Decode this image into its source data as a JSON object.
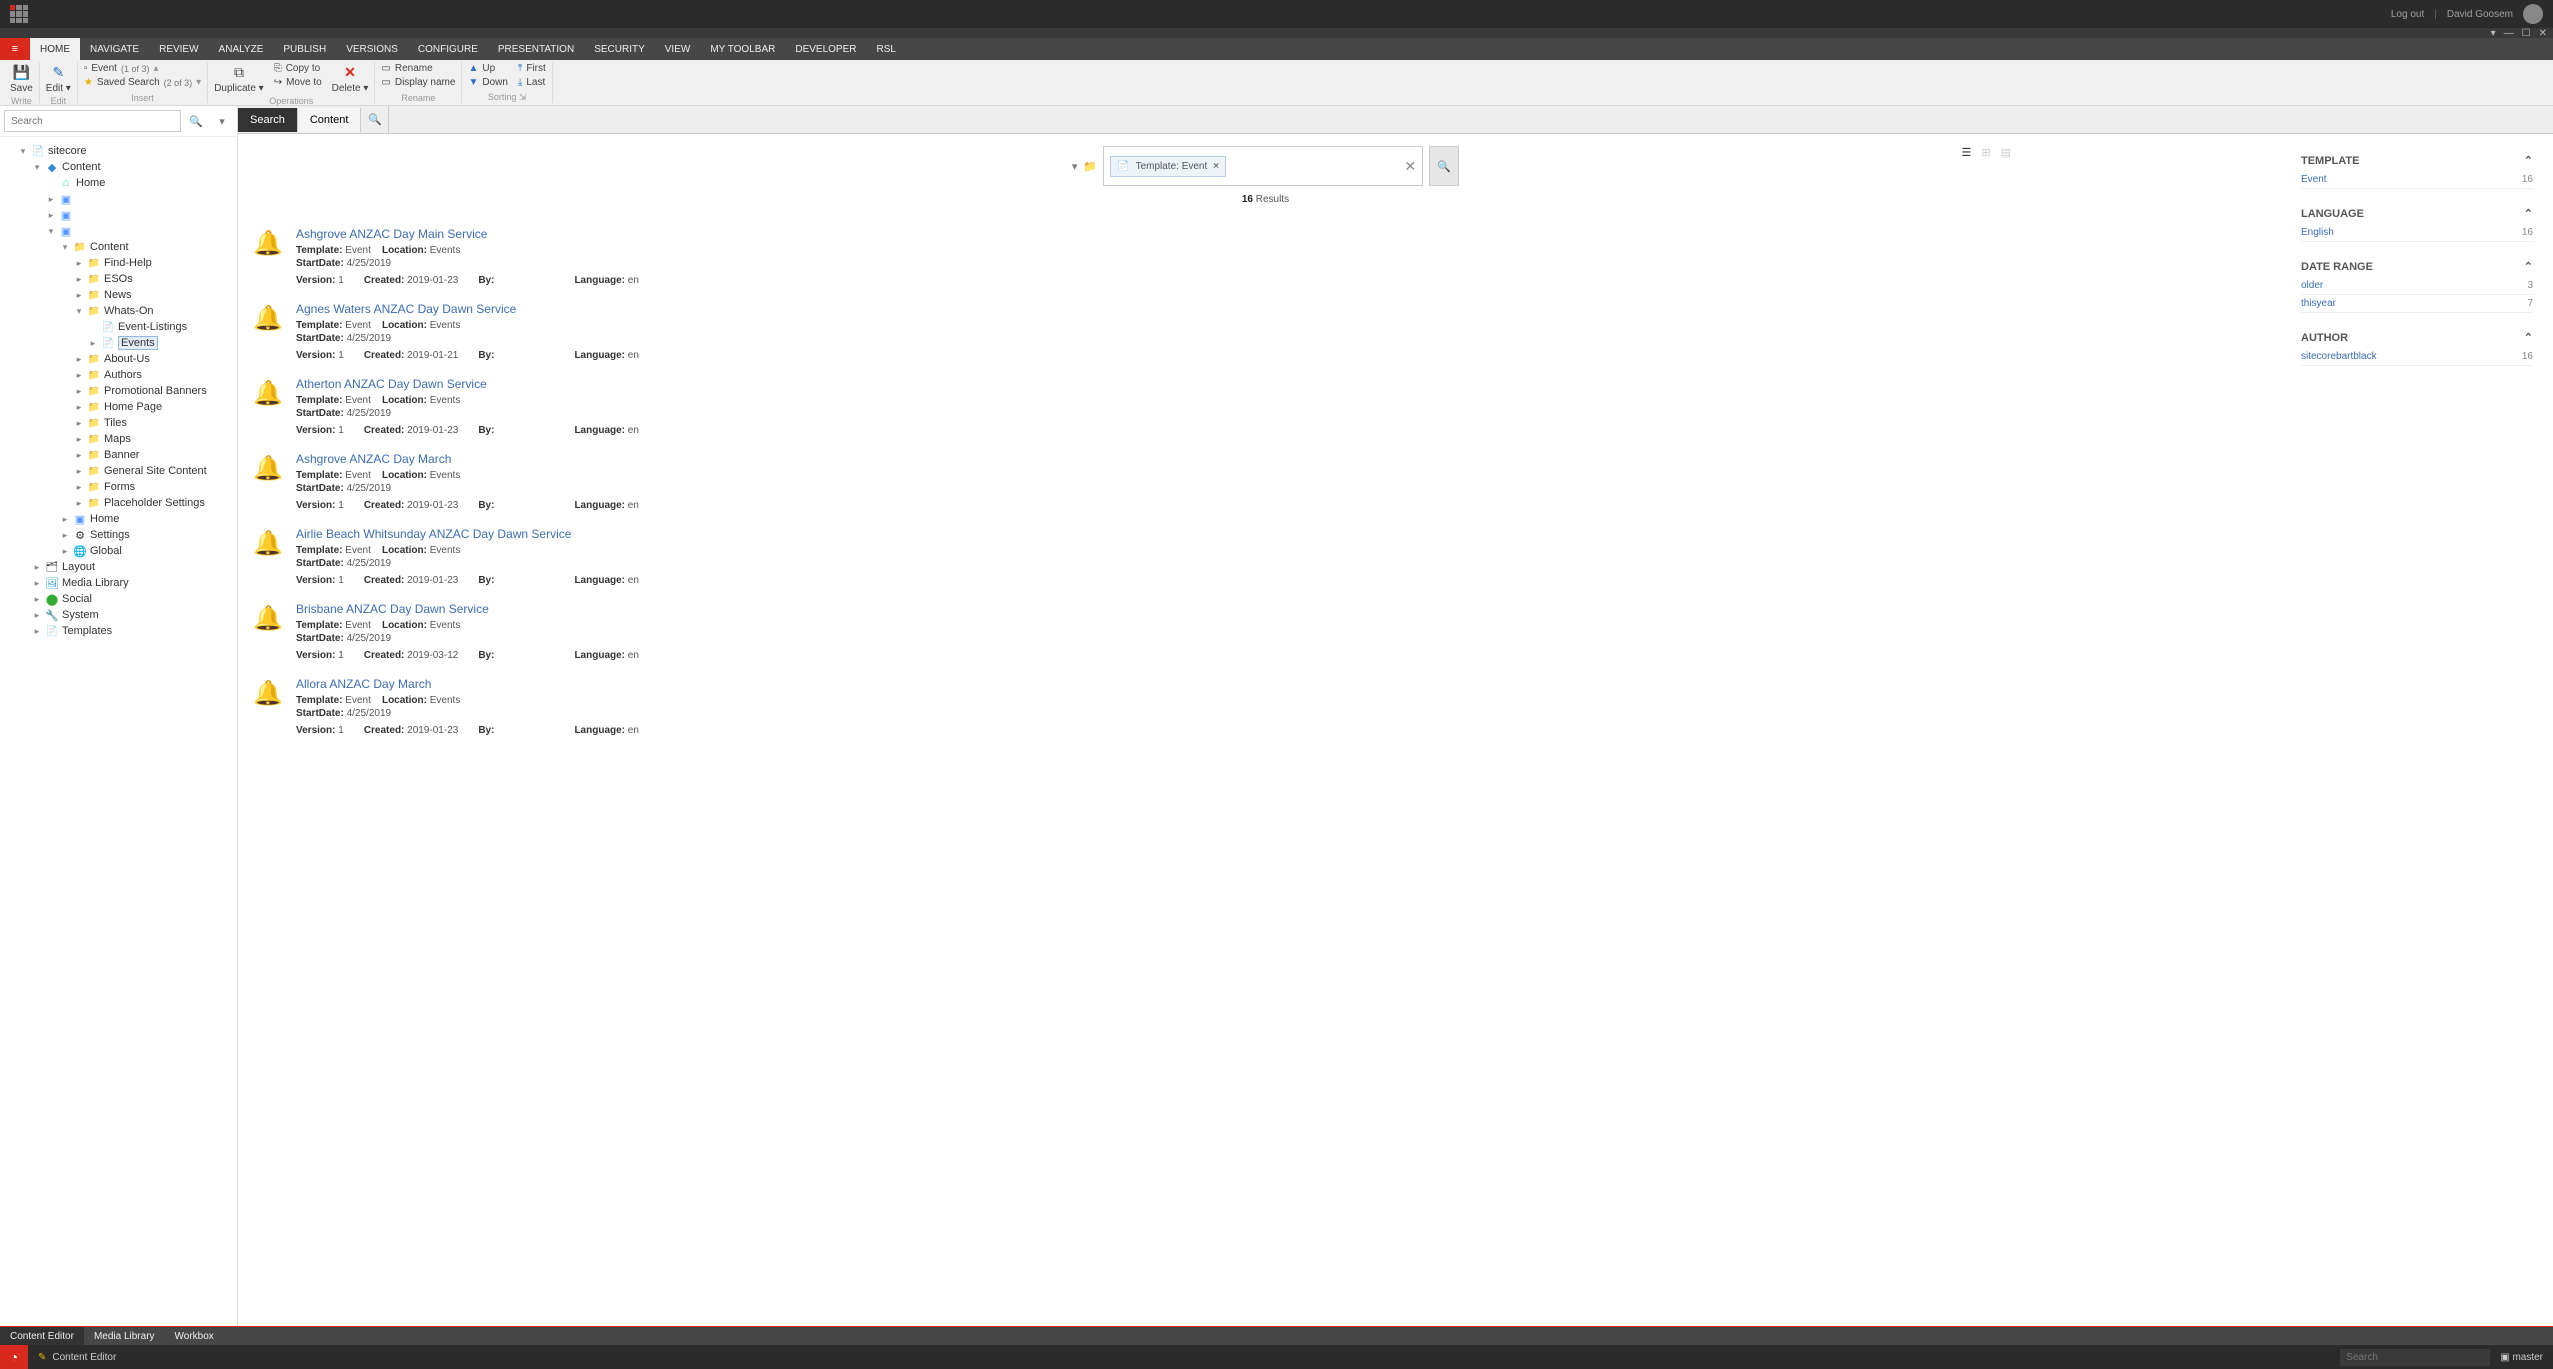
{
  "topbar": {
    "logout": "Log out",
    "username": "David Goosem"
  },
  "ribbonTabs": [
    "HOME",
    "NAVIGATE",
    "REVIEW",
    "ANALYZE",
    "PUBLISH",
    "VERSIONS",
    "CONFIGURE",
    "PRESENTATION",
    "SECURITY",
    "VIEW",
    "MY TOOLBAR",
    "DEVELOPER",
    "RSL"
  ],
  "ribbon": {
    "save": "Save",
    "write": "Write",
    "edit": "Edit",
    "editGroup": "Edit",
    "insert_event": "Event",
    "insert_event_count": "(1 of 3)",
    "insert_saved": "Saved Search",
    "insert_saved_count": "(2 of 3)",
    "insert": "Insert",
    "duplicate": "Duplicate",
    "copyto": "Copy to",
    "moveto": "Move to",
    "delete": "Delete",
    "operations": "Operations",
    "rename": "Rename",
    "displayname": "Display name",
    "renameGroup": "Rename",
    "up": "Up",
    "down": "Down",
    "first": "First",
    "last": "Last",
    "sorting": "Sorting"
  },
  "treeSearch": {
    "placeholder": "Search"
  },
  "tree": {
    "root": "sitecore",
    "content": "Content",
    "home": "Home",
    "contentFolder": "Content",
    "findHelp": "Find-Help",
    "esos": "ESOs",
    "news": "News",
    "whatsOn": "Whats-On",
    "eventListings": "Event-Listings",
    "events": "Events",
    "aboutUs": "About-Us",
    "authors": "Authors",
    "promoBanners": "Promotional Banners",
    "homePage": "Home Page",
    "tiles": "Tiles",
    "maps": "Maps",
    "banner": "Banner",
    "gsc": "General Site Content",
    "forms": "Forms",
    "placeholder": "Placeholder Settings",
    "home2": "Home",
    "settings": "Settings",
    "global": "Global",
    "layout": "Layout",
    "mediaLibrary": "Media Library",
    "social": "Social",
    "system": "System",
    "templates": "Templates"
  },
  "contentTabs": {
    "search": "Search",
    "content": "Content"
  },
  "searchFilter": {
    "label": "Template:",
    "value": "Event"
  },
  "resultCount": {
    "num": "16",
    "label": "Results"
  },
  "results": [
    {
      "title": "Ashgrove ANZAC Day Main Service",
      "template": "Event",
      "location": "Events",
      "startDate": "4/25/2019",
      "version": "1",
      "created": "2019-01-23",
      "by": "",
      "language": "en"
    },
    {
      "title": "Agnes Waters ANZAC Day Dawn Service",
      "template": "Event",
      "location": "Events",
      "startDate": "4/25/2019",
      "version": "1",
      "created": "2019-01-21",
      "by": "",
      "language": "en"
    },
    {
      "title": "Atherton ANZAC Day Dawn Service",
      "template": "Event",
      "location": "Events",
      "startDate": "4/25/2019",
      "version": "1",
      "created": "2019-01-23",
      "by": "",
      "language": "en"
    },
    {
      "title": "Ashgrove ANZAC Day March",
      "template": "Event",
      "location": "Events",
      "startDate": "4/25/2019",
      "version": "1",
      "created": "2019-01-23",
      "by": "",
      "language": "en"
    },
    {
      "title": "Airlie Beach Whitsunday ANZAC Day Dawn Service",
      "template": "Event",
      "location": "Events",
      "startDate": "4/25/2019",
      "version": "1",
      "created": "2019-01-23",
      "by": "",
      "language": "en"
    },
    {
      "title": "Brisbane ANZAC Day Dawn Service",
      "template": "Event",
      "location": "Events",
      "startDate": "4/25/2019",
      "version": "1",
      "created": "2019-03-12",
      "by": "",
      "language": "en"
    },
    {
      "title": "Allora ANZAC Day March",
      "template": "Event",
      "location": "Events",
      "startDate": "4/25/2019",
      "version": "1",
      "created": "2019-01-23",
      "by": "",
      "language": "en"
    }
  ],
  "labels": {
    "template": "Template:",
    "location": "Location:",
    "startDate": "StartDate:",
    "version": "Version:",
    "created": "Created:",
    "by": "By:",
    "language": "Language:"
  },
  "facets": {
    "template": {
      "head": "TEMPLATE",
      "items": [
        {
          "label": "Event",
          "count": "16"
        }
      ]
    },
    "language": {
      "head": "LANGUAGE",
      "items": [
        {
          "label": "English",
          "count": "16"
        }
      ]
    },
    "dateRange": {
      "head": "DATE RANGE",
      "items": [
        {
          "label": "older",
          "count": "3"
        },
        {
          "label": "thisyear",
          "count": "7"
        }
      ]
    },
    "author": {
      "head": "AUTHOR",
      "items": [
        {
          "label": "sitecorebartblack",
          "count": "16"
        }
      ]
    }
  },
  "bottomTabs": [
    "Content Editor",
    "Media Library",
    "Workbox"
  ],
  "status": {
    "current": "Content Editor",
    "searchPlaceholder": "Search",
    "db": "master"
  }
}
